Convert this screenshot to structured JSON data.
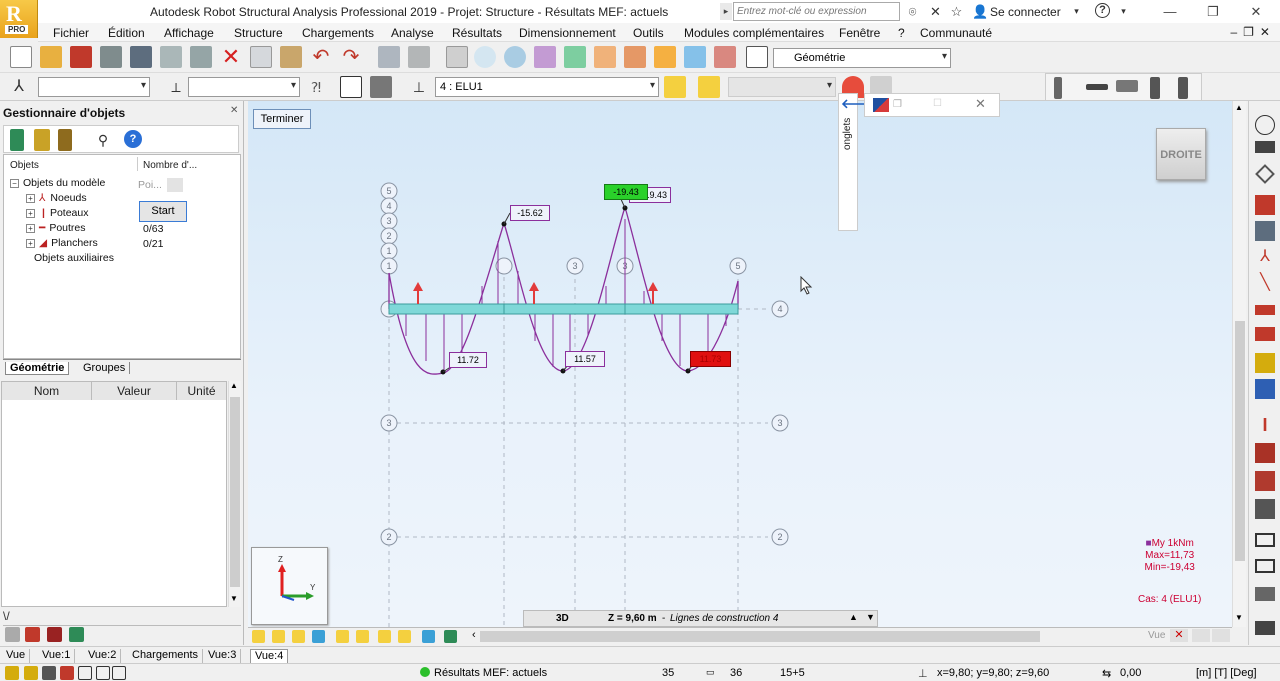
{
  "titlebar": {
    "logo_letter": "R",
    "logo_badge": "PRO",
    "title": "Autodesk Robot Structural Analysis Professional 2019 - Projet: Structure - Résultats MEF: actuels",
    "search_placeholder": "Entrez mot-clé ou expression",
    "sign_in": "Se connecter",
    "help": "?"
  },
  "menu": [
    "Fichier",
    "Édition",
    "Affichage",
    "Structure",
    "Chargements",
    "Analyse",
    "Résultats",
    "Dimensionnement",
    "Outils",
    "Modules complémentaires",
    "Fenêtre",
    "?",
    "Communauté"
  ],
  "toolbar": {
    "geometry_combo": "Géométrie",
    "case_combo": "4 : ELU1"
  },
  "object_manager": {
    "title": "Gestionnaire d'objets",
    "col_objects": "Objets",
    "col_count": "Nombre d'...",
    "model_objects": "Objets du modèle",
    "poi_label": "Poi...",
    "nodes": "Noeuds",
    "columns": "Poteaux",
    "beams": "Poutres",
    "beams_count": "0/63",
    "floors": "Planchers",
    "floors_count": "0/21",
    "aux_objects": "Objets auxiliaires",
    "start_button": "Start",
    "tab_geometry": "Géométrie",
    "tab_groups": "Groupes",
    "prop_name": "Nom",
    "prop_value": "Valeur",
    "prop_unit": "Unité"
  },
  "viewport": {
    "finish_button": "Terminer",
    "view_cube": "DROITE",
    "onglets": "onglets",
    "labels": [
      "-15.62",
      "-19.43",
      "-19.43",
      "11.72",
      "11.57",
      "11.73"
    ],
    "grid_tags": [
      "5",
      "4",
      "3",
      "2",
      "1",
      "1",
      "5",
      "3",
      "3",
      "5",
      "4",
      "3",
      "2"
    ],
    "legend_title": "My  1kNm",
    "legend_max": "Max=11,73",
    "legend_min": "Min=-19,43",
    "legend_case": "Cas: 4 (ELU1)",
    "view_mode": "3D",
    "view_plane": "Z = 9,60 m",
    "view_plane_desc": "Lignes de construction 4",
    "vue_label": "Vue",
    "axis_z": "Z",
    "axis_y": "Y"
  },
  "view_tabs": [
    "Vue",
    "Vue:1",
    "Vue:2",
    "Chargements",
    "Vue:3",
    "Vue:4"
  ],
  "status": {
    "results": "Résultats MEF: actuels",
    "n1": "35",
    "n2": "36",
    "n3": "15+5",
    "coords": "x=9,80; y=9,80; z=9,60",
    "angle": "0,00",
    "units": "[m] [T] [Deg]"
  },
  "colors": {
    "beam": "#7fd8d8",
    "diagram": "#8b2f9c",
    "support_arrow": "#e23b3b",
    "min_label_bg": "#2ad12a",
    "max_label_bg": "#e01010",
    "legend": "#cc0033"
  }
}
